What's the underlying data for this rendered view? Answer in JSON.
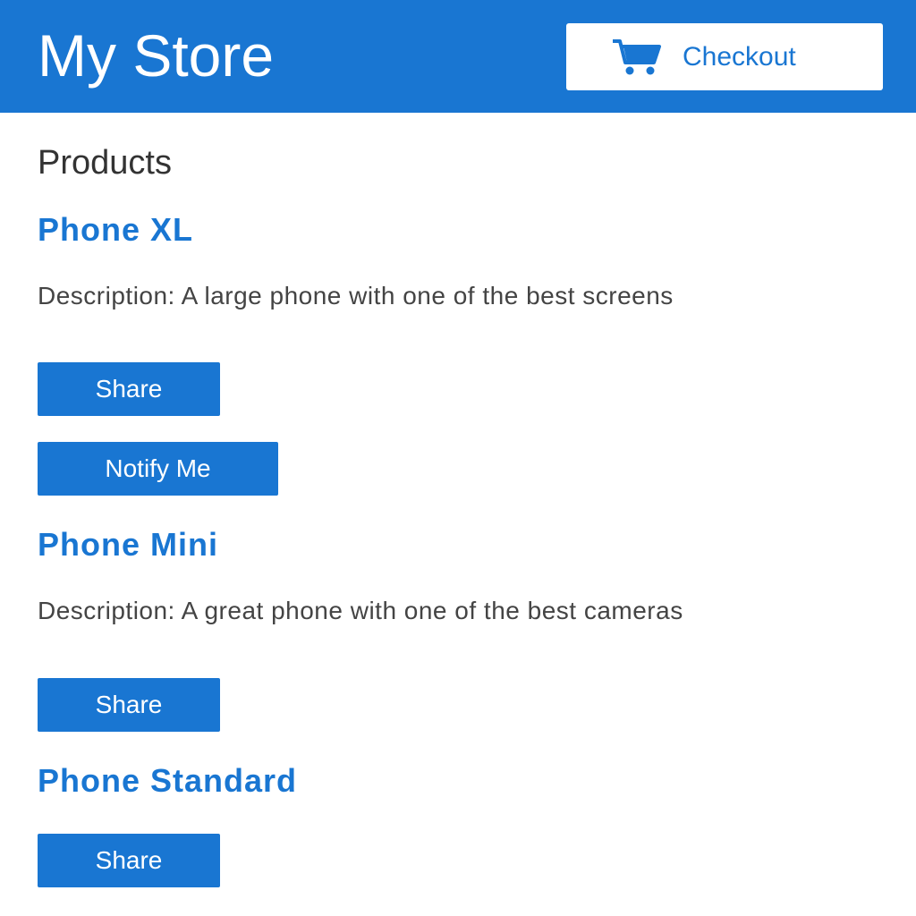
{
  "header": {
    "title": "My Store",
    "checkout_label": "Checkout",
    "checkout_icon": "shopping-cart-icon",
    "background_color": "#1976d2"
  },
  "main": {
    "heading": "Products",
    "products": [
      {
        "name": "Phone XL",
        "description": "Description: A large phone with one of the best screens",
        "share_label": "Share",
        "notify_label": "Notify Me"
      },
      {
        "name": "Phone Mini",
        "description": "Description: A great phone with one of the best cameras",
        "share_label": "Share"
      },
      {
        "name": "Phone Standard",
        "share_label": "Share"
      }
    ]
  }
}
